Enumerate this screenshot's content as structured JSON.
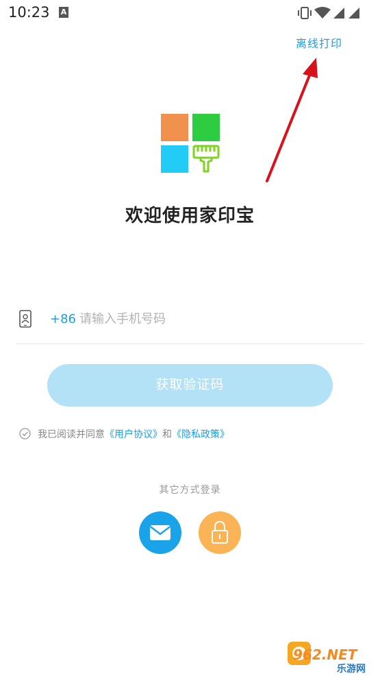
{
  "status_bar": {
    "time": "10:23",
    "notification_icon": "A",
    "icons": [
      "vibrate-icon",
      "wifi-icon",
      "signal-icon",
      "signal-icon"
    ]
  },
  "header": {
    "offline_print_label": "离线打印"
  },
  "welcome_title": "欢迎使用家印宝",
  "phone": {
    "country_code": "+86",
    "placeholder": "请输入手机号码",
    "value": ""
  },
  "get_code_button": "获取验证码",
  "agreement": {
    "prefix": "我已阅读并同意",
    "user_agreement": "《用户协议》",
    "and": "和",
    "privacy_policy": "《隐私政策》"
  },
  "other_login": {
    "label": "其它方式登录",
    "methods": [
      "mail-icon",
      "lock-icon"
    ]
  },
  "colors": {
    "accent": "#1a9ee6",
    "button_disabled": "#b3e2f7",
    "logo_orange": "#f0924e",
    "logo_green": "#2ecc40",
    "logo_blue": "#22ccf7",
    "brush_green": "#7ed321",
    "mail_bg": "#1aa3e8",
    "lock_bg": "#fbb455"
  },
  "watermark": {
    "text_top": "962.NET",
    "text_bottom": "乐游网"
  }
}
